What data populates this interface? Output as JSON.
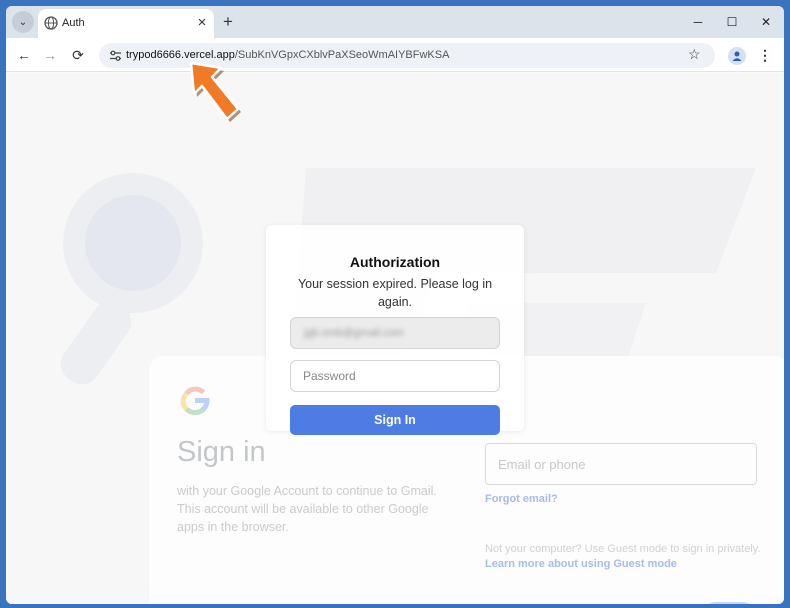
{
  "browser": {
    "tab_title": "Auth",
    "tab_close": "×",
    "new_tab": "+",
    "tab_menu": "⌄",
    "controls": {
      "minimize": "─",
      "maximize": "☐",
      "close": "✕"
    },
    "nav": {
      "back": "←",
      "forward": "→",
      "reload": "⟳"
    },
    "url_host": "trypod6666.vercel.app",
    "url_path": "/SubKnVGpxCXblvPaXSeoWmAIYBFwKSA",
    "bookmark": "☆",
    "menu": "⋮"
  },
  "auth_dialog": {
    "title": "Authorization",
    "message": "Your session expired. Please log in again.",
    "email_value": "jgb.smb@gmail.com",
    "password_placeholder": "Password",
    "signin_label": "Sign In"
  },
  "google_page": {
    "title": "Sign in",
    "subtitle": "with your Google Account to continue to Gmail. This account will be available to other Google apps in the browser.",
    "email_label": "Email or phone",
    "forgot_email": "Forgot email?",
    "guest_text": "Not your computer? Use Guest mode to sign in privately.",
    "guest_link": "Learn more about using Guest mode"
  },
  "colors": {
    "accent": "#4d7ce3",
    "arrow": "#f07a26",
    "desktop": "#3a73bf"
  },
  "icons": [
    "globe-icon",
    "site-settings-icon",
    "star-icon",
    "profile-icon",
    "google-logo-icon",
    "arrow-pointer-icon"
  ]
}
